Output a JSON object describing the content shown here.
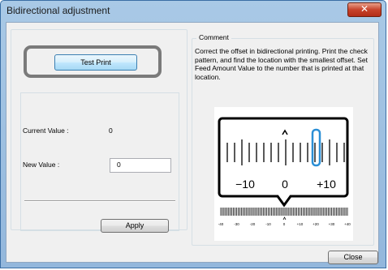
{
  "window": {
    "title": "Bidirectional adjustment",
    "close_glyph": "✕"
  },
  "buttons": {
    "test_print": "Test Print",
    "apply": "Apply",
    "close": "Close"
  },
  "fields": {
    "current_value_label": "Current Value :",
    "current_value": "0",
    "new_value_label": "New Value :",
    "new_value": "0"
  },
  "comment": {
    "title": "Comment",
    "text": "Correct the offset in bidirectional printing. Print the check pattern, and find the location with the smallest offset. Set Feed Amount Value to the number that is printed at that location."
  },
  "pattern": {
    "zoom_labels": [
      "−10",
      "0",
      "+10"
    ],
    "scale_labels": [
      "-40",
      "-30",
      "-20",
      "-10",
      "0",
      "+10",
      "+20",
      "+30",
      "+40"
    ],
    "highlight_color": "#2b8fd6"
  }
}
